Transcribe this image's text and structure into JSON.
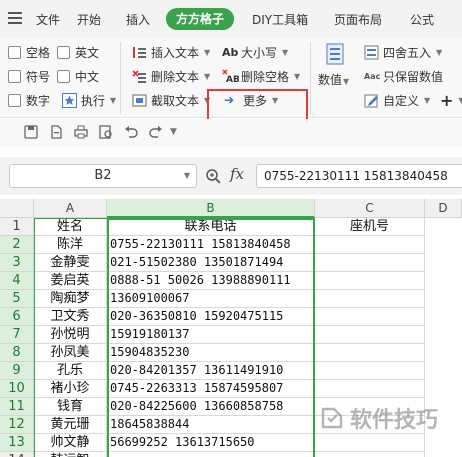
{
  "tabs": {
    "file": "文件",
    "start": "开始",
    "insert": "插入",
    "active": "方方格子",
    "diy": "DIY工具箱",
    "layout": "页面布局",
    "formula": "公式"
  },
  "ribbon": {
    "checkboxes": [
      "空格",
      "英文",
      "符号",
      "中文",
      "数字"
    ],
    "execute": "执行",
    "insert_text": "插入文本",
    "delete_text": "删除文本",
    "extract_text": "截取文本",
    "more": "更多",
    "case": "大小写",
    "delete_space": "删除空格",
    "numeric": "数值",
    "round": "四舍五入",
    "keep_value": "只保留数值",
    "custom": "自定义",
    "plus": "+"
  },
  "namebox": "B2",
  "formula_value": "0755-22130111  15813840458",
  "columns": [
    "A",
    "B",
    "C",
    "D"
  ],
  "header_row": {
    "row": "1",
    "a": "姓名",
    "b": "联系电话",
    "c": "座机号"
  },
  "rows": [
    {
      "row": "2",
      "a": "陈洋",
      "b": "0755-22130111  15813840458"
    },
    {
      "row": "3",
      "a": "金静雯",
      "b": "021-51502380  13501871494"
    },
    {
      "row": "4",
      "a": "姜启英",
      "b": "0888-51 50026 13988890111"
    },
    {
      "row": "5",
      "a": "陶痴梦",
      "b": "13609100067"
    },
    {
      "row": "6",
      "a": "卫文秀",
      "b": "020-36350810  15920475115"
    },
    {
      "row": "7",
      "a": "孙悦明",
      "b": "15919180137"
    },
    {
      "row": "8",
      "a": "孙凤美",
      "b": "15904835230"
    },
    {
      "row": "9",
      "a": "孔乐",
      "b": "020-84201357  13611491910"
    },
    {
      "row": "10",
      "a": "褚小珍",
      "b": "0745-2263313  15874595807"
    },
    {
      "row": "11",
      "a": "钱育",
      "b": "020-84225600  13660858758"
    },
    {
      "row": "12",
      "a": "黄元珊",
      "b": "18645838844"
    },
    {
      "row": "13",
      "a": "帅文静",
      "b": "56699252  13613715650"
    },
    {
      "row": "14",
      "a": "韩远智",
      "b": ""
    }
  ],
  "watermark": "软件技巧",
  "colors": {
    "accent": "#3aa34a",
    "highlight": "#e23b3b"
  }
}
